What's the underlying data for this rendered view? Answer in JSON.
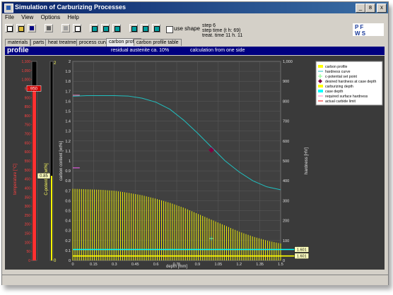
{
  "window": {
    "title": "Simulation of Carburizing Processes"
  },
  "window_buttons": {
    "minimize": "_",
    "maximize": "8",
    "close": "x"
  },
  "menu": [
    "File",
    "View",
    "Options",
    "Help"
  ],
  "toolbar": {
    "use_shape_label": "use shape"
  },
  "step_info": [
    "step 6",
    "step time (t h: 69)",
    "treat. time 11 h. 11"
  ],
  "logo": {
    "top": "P F",
    "bottom": "W S"
  },
  "tabs": [
    "materials",
    "parts",
    "heat treatments",
    "process curves",
    "carbon profile",
    "carbon profile table"
  ],
  "active_tab": 4,
  "header": {
    "title": "profile",
    "retained_austenite": "residual austenite ca. 10%",
    "calc_note": "calculation from one side"
  },
  "colors": {
    "accent": "#000080",
    "carbon": "#ffff00",
    "hardness": "#20c0c0",
    "setpoint": "#80ff80",
    "desired": "#800040",
    "case_depth": "#00ffff",
    "required": "#ff80c0",
    "carbide": "#ff0000",
    "temperature": "#ff0000"
  },
  "side_gauges": {
    "temp_label": "temperature [°C]",
    "temp_ticks": [
      "1,100",
      "1,050",
      "1,000",
      "950",
      "900",
      "850",
      "800",
      "750",
      "700",
      "650",
      "600",
      "550",
      "500",
      "450",
      "400",
      "350",
      "300",
      "250",
      "200",
      "150",
      "100",
      "50",
      "0"
    ],
    "temp_value": "950",
    "temp_level": 0.864,
    "carbon_label": "C-potential [wt%]",
    "carbon_top": "2",
    "carbon_bottom": "0",
    "carbon_value": "0.85",
    "carbon_level": 0.425
  },
  "chart_data": {
    "type": "bar",
    "xlabel": "depth [mm]",
    "ylabel": "carbon content [wt%]",
    "y2label": "hardness [HV]",
    "xlim": [
      0,
      1.5
    ],
    "ylim": [
      0,
      2
    ],
    "y2lim": [
      0,
      1000
    ],
    "x_ticks": [
      "0",
      "0.15",
      "0.3",
      "0.45",
      "0.6",
      "0.75",
      "0.9",
      "1.05",
      "1.2",
      "1.35",
      "1.5"
    ],
    "y_ticks": [
      "0",
      "0.1",
      "0.2",
      "0.3",
      "0.4",
      "0.5",
      "0.6",
      "0.7",
      "0.8",
      "0.9",
      "1",
      "1.1",
      "1.2",
      "1.3",
      "1.4",
      "1.5",
      "1.6",
      "1.7",
      "1.8",
      "1.9",
      "2"
    ],
    "y2_ticks": [
      "0",
      "100",
      "200",
      "300",
      "400",
      "500",
      "600",
      "700",
      "800",
      "900",
      "1,000"
    ],
    "legend": [
      "carbon profile",
      "hardness curve",
      "c-potential set point",
      "desired hardness at case depth",
      "carburizing depth",
      "case depth",
      "required surface hardness",
      "actual carbide limit"
    ],
    "legend_position": "top-right",
    "carbon_profile": {
      "name": "carbon profile",
      "x": [
        0,
        0.1,
        0.2,
        0.3,
        0.4,
        0.5,
        0.6,
        0.7,
        0.8,
        0.9,
        1.0,
        1.1,
        1.2,
        1.3,
        1.4,
        1.5
      ],
      "y": [
        0.72,
        0.715,
        0.71,
        0.7,
        0.68,
        0.655,
        0.62,
        0.58,
        0.53,
        0.47,
        0.41,
        0.35,
        0.29,
        0.24,
        0.2,
        0.17
      ]
    },
    "hardness_curve": {
      "name": "hardness curve",
      "x": [
        0,
        0.1,
        0.2,
        0.3,
        0.4,
        0.5,
        0.6,
        0.7,
        0.8,
        0.9,
        1.0,
        1.1,
        1.2,
        1.3,
        1.4,
        1.5
      ],
      "y": [
        825,
        828,
        828,
        828,
        826,
        815,
        795,
        760,
        705,
        640,
        570,
        500,
        445,
        400,
        370,
        355
      ]
    },
    "desired_hardness_point": {
      "x": 1.0,
      "y": 555
    },
    "cpot_setpoint_point": {
      "x": 1.0,
      "y": 0.22
    },
    "required_surface_hardness": {
      "x": [
        0,
        0.05
      ],
      "y": 830
    },
    "actual_carbide_limit": {
      "x": [
        0,
        0.05
      ],
      "y": 0.93
    },
    "carburizing_depth": {
      "value": 1.601,
      "label": "1.601",
      "y": 0.045
    },
    "case_depth": {
      "value": 1.601,
      "label": "1.601",
      "y": 0.11
    }
  }
}
